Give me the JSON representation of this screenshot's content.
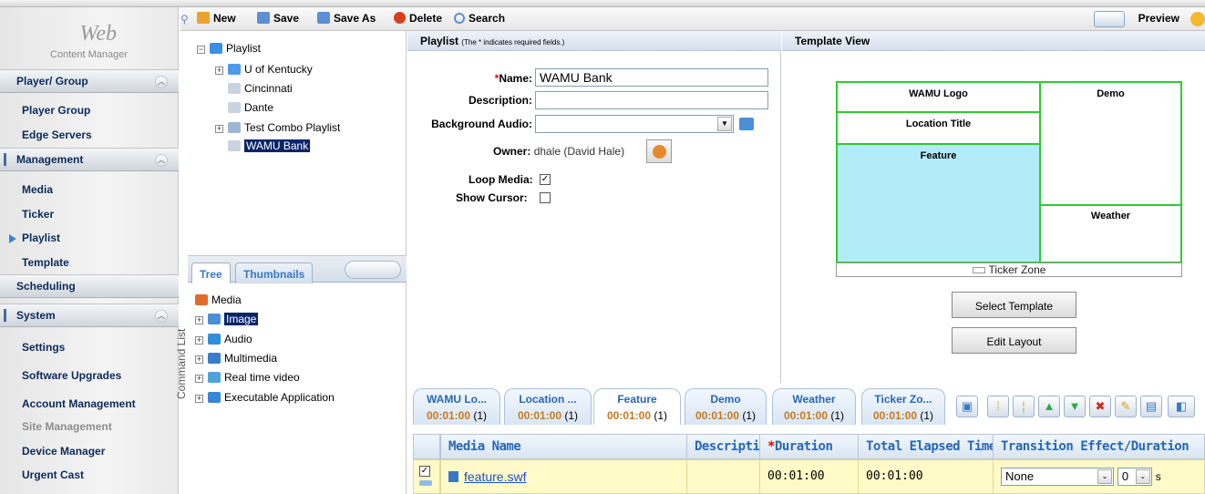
{
  "logo": {
    "web": "Web",
    "sub": "Content Manager"
  },
  "sidebar": {
    "sections": [
      {
        "label": "Player/ Group"
      },
      {
        "label": "Management"
      },
      {
        "label": "Scheduling"
      },
      {
        "label": "System"
      }
    ],
    "items": [
      {
        "label": "Player Group"
      },
      {
        "label": "Edge Servers"
      },
      {
        "label": "Media"
      },
      {
        "label": "Ticker"
      },
      {
        "label": "Playlist"
      },
      {
        "label": "Template"
      },
      {
        "label": "Settings"
      },
      {
        "label": "Software Upgrades"
      },
      {
        "label": "Account Management"
      },
      {
        "label": "Site Management"
      },
      {
        "label": "Device Manager"
      },
      {
        "label": "Urgent Cast"
      }
    ],
    "command_list": "Command List"
  },
  "toolbar": {
    "new": "New",
    "save": "Save",
    "save_as": "Save As",
    "delete": "Delete",
    "search": "Search",
    "preview": "Preview"
  },
  "tree": {
    "root": "Playlist",
    "items": [
      "U of Kentucky",
      "Cincinnati",
      "Dante",
      "Test Combo Playlist",
      "WAMU Bank"
    ]
  },
  "tabs": {
    "tree": "Tree",
    "thumbnails": "Thumbnails"
  },
  "media_tree": {
    "root": "Media",
    "items": [
      "Image",
      "Audio",
      "Multimedia",
      "Real time video",
      "Executable Application"
    ]
  },
  "form": {
    "title": "Playlist",
    "note": "(The * indicates required fields.)",
    "name_label": "Name:",
    "name_value": "WAMU Bank",
    "description_label": "Description:",
    "description_value": "",
    "bg_audio_label": "Background Audio:",
    "bg_audio_value": "",
    "owner_label": "Owner:",
    "owner_value": "dhale (David Hale)",
    "loop_label": "Loop Media:",
    "loop_checked": true,
    "cursor_label": "Show Cursor:",
    "cursor_checked": false
  },
  "template_view": {
    "title": "Template View",
    "zones": {
      "logo": "WAMU Logo",
      "demo": "Demo",
      "location": "Location Title",
      "feature": "Feature",
      "weather": "Weather",
      "ticker": "Ticker Zone"
    },
    "select_template": "Select Template",
    "edit_layout": "Edit Layout",
    "colors": {
      "zone_border": "#2ecc2e",
      "feature_fill": "#b3ecf9"
    }
  },
  "zone_tabs": [
    {
      "name": "WAMU Lo...",
      "time": "00:01:00",
      "count": "(1)"
    },
    {
      "name": "Location ...",
      "time": "00:01:00",
      "count": "(1)"
    },
    {
      "name": "Feature",
      "time": "00:01:00",
      "count": "(1)"
    },
    {
      "name": "Demo",
      "time": "00:01:00",
      "count": "(1)"
    },
    {
      "name": "Weather",
      "time": "00:01:00",
      "count": "(1)"
    },
    {
      "name": "Ticker Zo...",
      "time": "00:01:00",
      "count": "(1)"
    }
  ],
  "table": {
    "headers": {
      "media_name": "Media Name",
      "description": "Description",
      "duration_req": "*",
      "duration": "Duration",
      "elapsed": "Total Elapsed Time",
      "transition": "Transition Effect/Duration"
    },
    "row": {
      "media": "feature.swf",
      "description": "",
      "duration": "00:01:00",
      "elapsed": "00:01:00",
      "transition": "None",
      "transition_duration": "0",
      "unit": "s",
      "checked": true
    }
  }
}
